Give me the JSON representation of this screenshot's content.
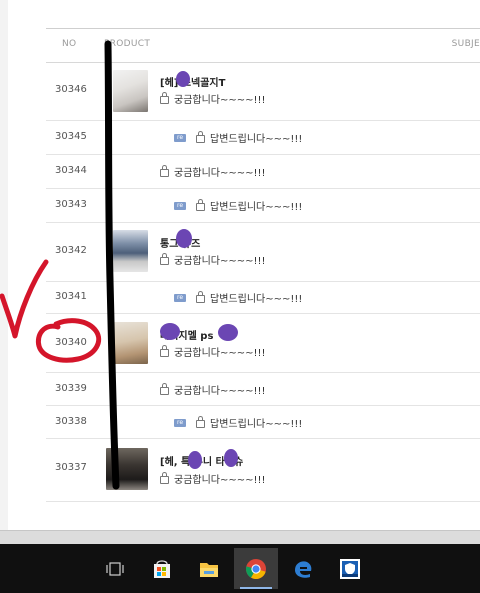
{
  "board": {
    "columns": {
      "no": "NO",
      "product": "PRODUCT",
      "subject": "SUBJE"
    },
    "re_badge": "re",
    "rows": [
      {
        "no": "30346",
        "title": "[헤] 스넥골지T",
        "subject": "궁금합니다~~~~!!!",
        "type": "product"
      },
      {
        "no": "30345",
        "subject": "답변드립니다~~~!!!",
        "type": "reply"
      },
      {
        "no": "30344",
        "subject": "궁금합니다~~~~!!!",
        "type": "question"
      },
      {
        "no": "30343",
        "subject": "답변드립니다~~~!!!",
        "type": "reply"
      },
      {
        "no": "30342",
        "title": "통그 슈즈",
        "subject": "궁금합니다~~~~!!!",
        "type": "product"
      },
      {
        "no": "30341",
        "subject": "답변드립니다~~~!!!",
        "type": "reply"
      },
      {
        "no": "30340",
        "title": "베이지멜 ps",
        "subject": "궁금합니다~~~~!!!",
        "type": "product"
      },
      {
        "no": "30339",
        "subject": "궁금합니다~~~~!!!",
        "type": "question"
      },
      {
        "no": "30338",
        "subject": "답변드립니다~~~!!!",
        "type": "reply"
      },
      {
        "no": "30337",
        "title": "[헤, 특 유니 타이슈",
        "subject": "궁금합니다~~~~!!!",
        "type": "product"
      }
    ]
  },
  "taskbar": {
    "icons": [
      "task-view-icon",
      "store-icon",
      "file-explorer-icon",
      "chrome-icon",
      "edge-icon",
      "security-app-icon"
    ],
    "active": "chrome-icon"
  },
  "colors": {
    "re_badge": "#7f9ccc",
    "redaction": "#6b46b3",
    "annotation_red": "#d4152a",
    "taskbar": "#101010"
  }
}
